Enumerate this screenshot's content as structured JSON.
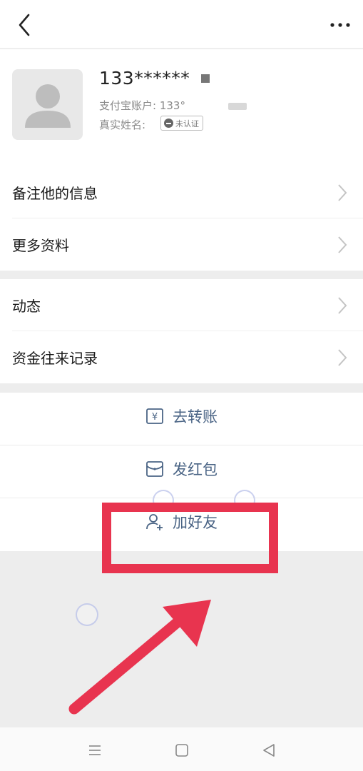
{
  "profile": {
    "name": "133******",
    "account_label": "支付宝账户: 133",
    "account_fragment": "°",
    "realname_label": "真实姓名:",
    "verify_badge": "未认证"
  },
  "menu": {
    "items": [
      {
        "label": "备注他的信息"
      },
      {
        "label": "更多资料"
      },
      {
        "label": "动态"
      },
      {
        "label": "资金往来记录"
      }
    ]
  },
  "actions": {
    "transfer": "去转账",
    "red_packet": "发红包",
    "add_friend": "加好友"
  },
  "colors": {
    "accent_text": "#4a6485",
    "highlight": "#e8344f",
    "background": "#ededed"
  },
  "icons": {
    "back": "back-arrow-icon",
    "more": "more-dots-icon",
    "transfer": "yen-card-icon",
    "red_packet": "envelope-icon",
    "add_friend": "add-user-icon"
  }
}
